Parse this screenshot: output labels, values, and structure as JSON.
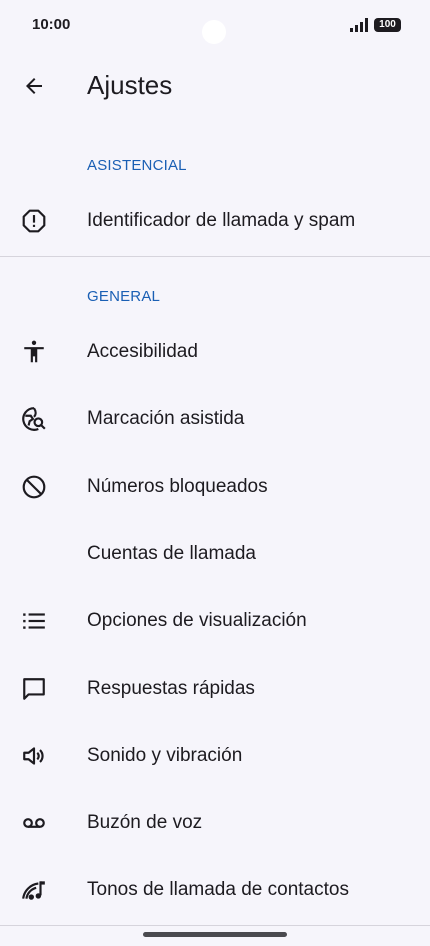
{
  "status_bar": {
    "time": "10:00",
    "battery": "100"
  },
  "app_bar": {
    "title": "Ajustes"
  },
  "sections": {
    "asistencial": {
      "header": "ASISTENCIAL",
      "items": [
        {
          "label": "Identificador de llamada y spam",
          "icon": "caller-id-spam-icon"
        }
      ]
    },
    "general": {
      "header": "GENERAL",
      "items": [
        {
          "label": "Accesibilidad",
          "icon": "accessibility-icon"
        },
        {
          "label": "Marcación asistida",
          "icon": "assisted-dialing-icon"
        },
        {
          "label": "Números bloqueados",
          "icon": "block-icon"
        },
        {
          "label": "Cuentas de llamada",
          "icon": ""
        },
        {
          "label": "Opciones de visualización",
          "icon": "list-icon"
        },
        {
          "label": "Respuestas rápidas",
          "icon": "chat-bubble-icon"
        },
        {
          "label": "Sonido y vibración",
          "icon": "speaker-icon"
        },
        {
          "label": "Buzón de voz",
          "icon": "voicemail-icon"
        },
        {
          "label": "Tonos de llamada de contactos",
          "icon": "contact-ringtone-icon"
        }
      ]
    }
  },
  "colors": {
    "background": "#f6f5fb",
    "accent": "#1a5fb4",
    "text": "#1d1b20"
  }
}
